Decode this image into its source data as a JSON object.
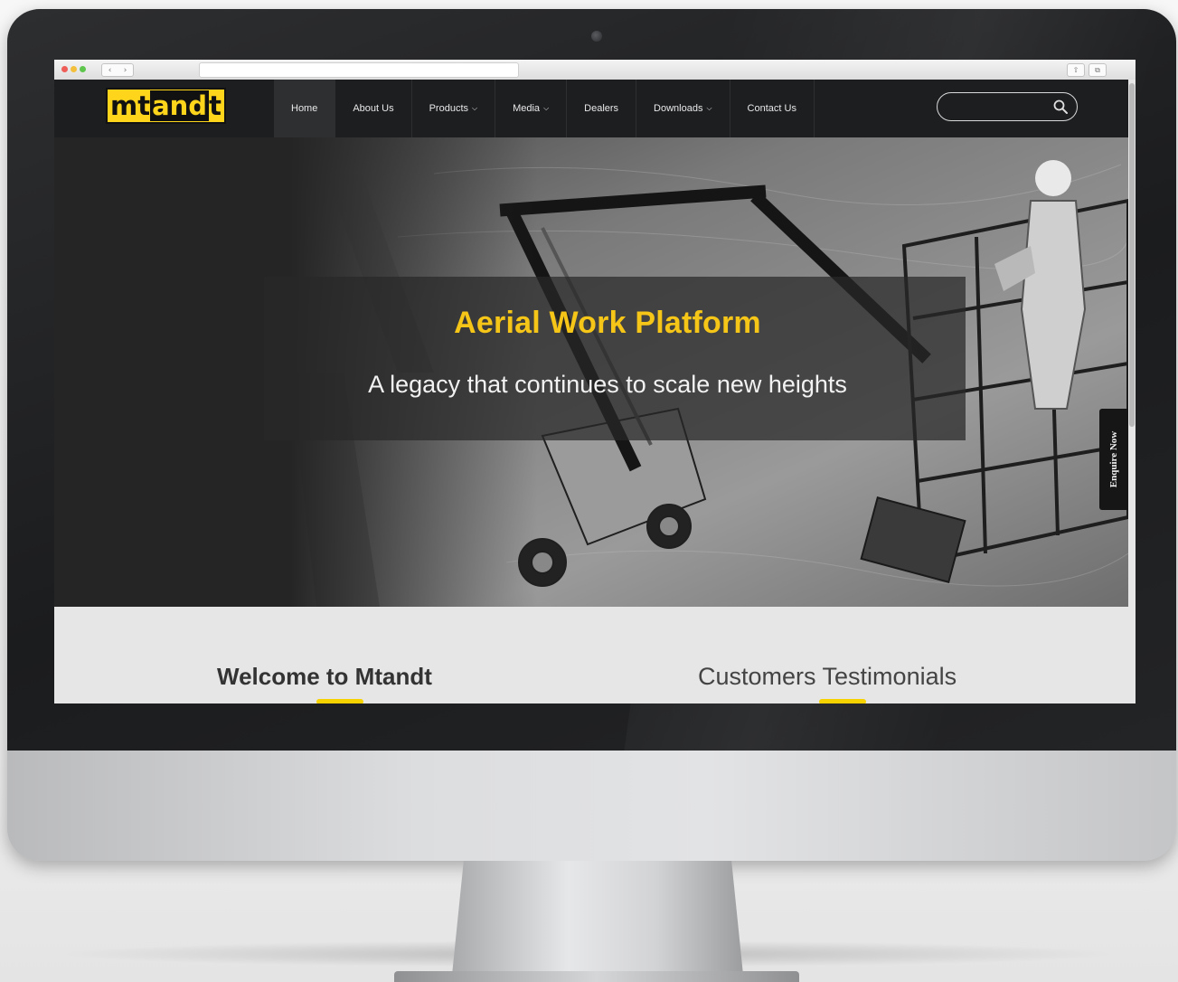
{
  "site": {
    "logo": {
      "part1": "mt",
      "part2": "and",
      "part3": "t"
    },
    "nav": [
      {
        "label": "Home",
        "active": true,
        "dropdown": false
      },
      {
        "label": "About Us",
        "active": false,
        "dropdown": false
      },
      {
        "label": "Products",
        "active": false,
        "dropdown": true
      },
      {
        "label": "Media",
        "active": false,
        "dropdown": true
      },
      {
        "label": "Dealers",
        "active": false,
        "dropdown": false
      },
      {
        "label": "Downloads",
        "active": false,
        "dropdown": true
      },
      {
        "label": "Contact Us",
        "active": false,
        "dropdown": false
      }
    ],
    "search": {
      "value": "",
      "placeholder": "",
      "icon": "search-icon"
    }
  },
  "hero": {
    "title": "Aerial Work Platform",
    "subtitle": "A legacy that continues to scale new heights",
    "enquire_label": "Enquire Now"
  },
  "sections": {
    "welcome_title": "Welcome to Mtandt",
    "testimonials_title": "Customers Testimonials"
  },
  "colors": {
    "brand_yellow": "#f5c518",
    "header_bg": "#1d1e20",
    "section_bg": "#e6e6e6"
  }
}
